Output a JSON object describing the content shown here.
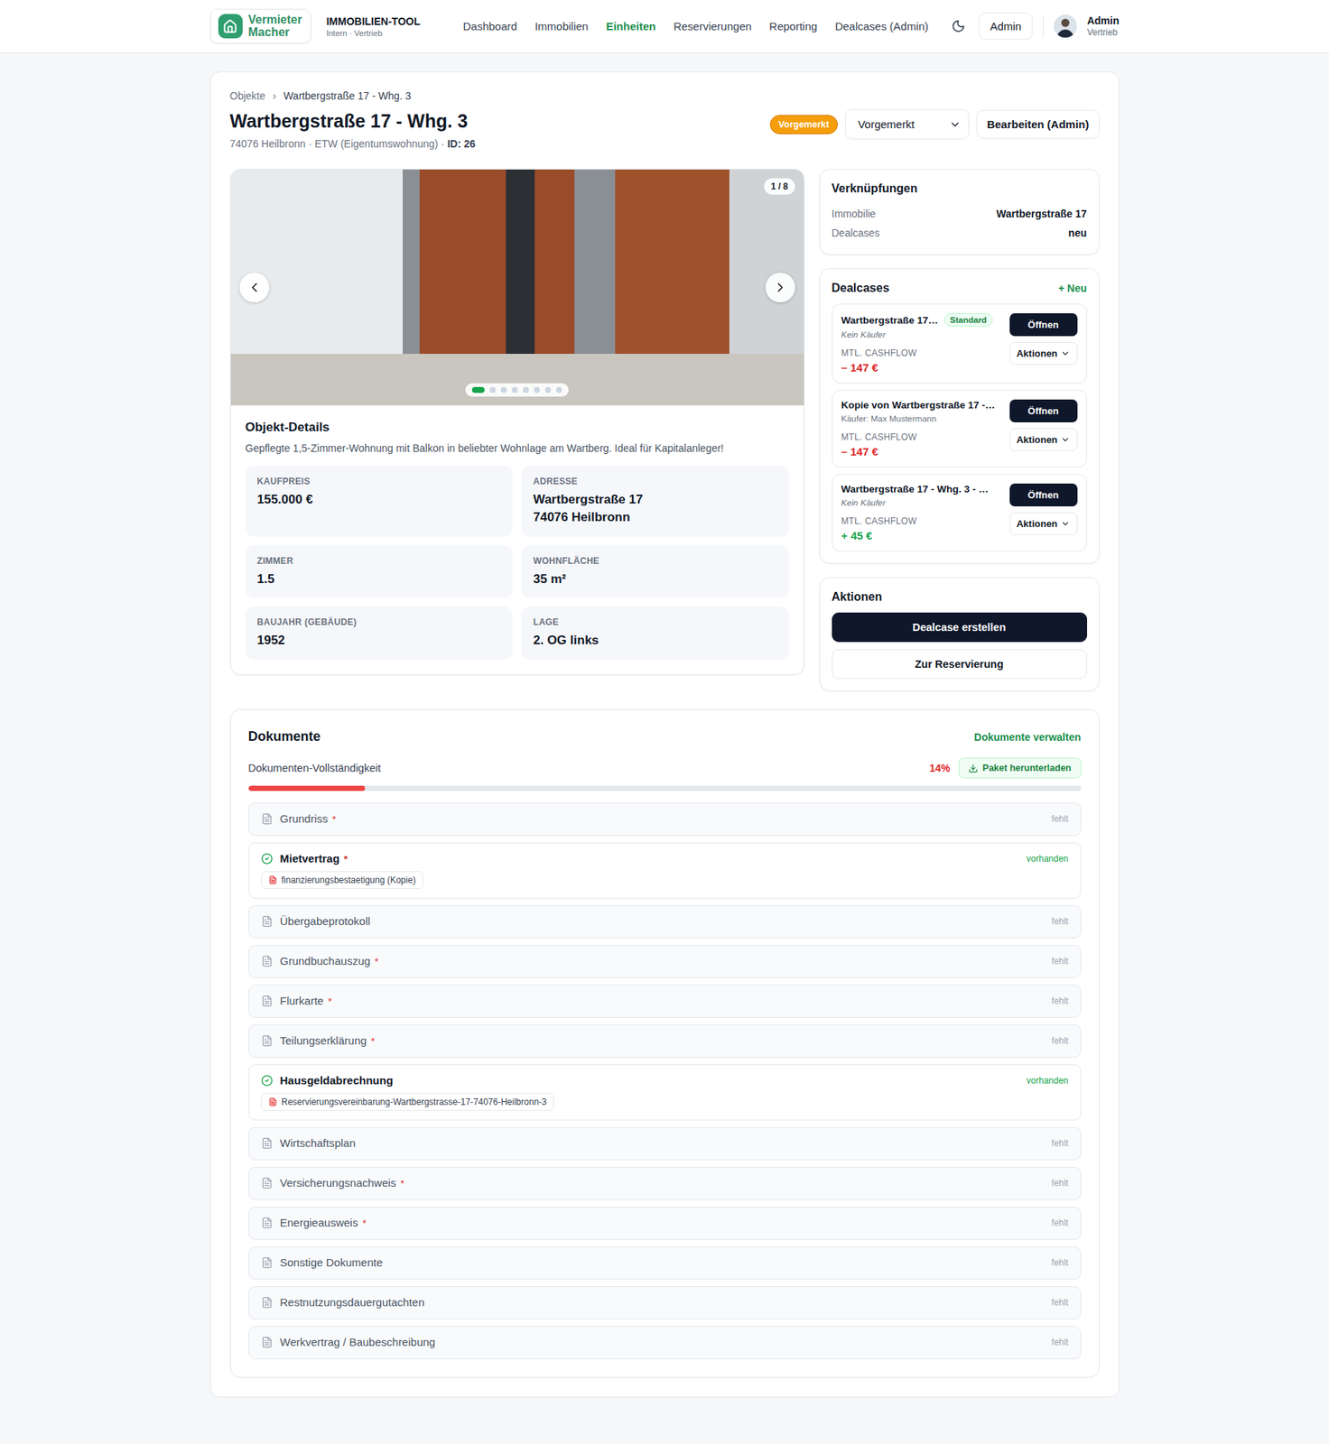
{
  "header": {
    "logo": {
      "line1": "Vermieter",
      "line2": "Macher"
    },
    "app_title": "IMMOBILIEN-TOOL",
    "app_subtitle": "Intern · Vertrieb",
    "nav": [
      {
        "label": "Dashboard",
        "selected": false
      },
      {
        "label": "Immobilien",
        "selected": false
      },
      {
        "label": "Einheiten",
        "selected": true
      },
      {
        "label": "Reservierungen",
        "selected": false
      },
      {
        "label": "Reporting",
        "selected": false
      },
      {
        "label": "Dealcases (Admin)",
        "selected": false
      }
    ],
    "role_button": "Admin",
    "user": {
      "name": "Admin",
      "role": "Vertrieb"
    }
  },
  "breadcrumb": {
    "parent": "Objekte",
    "separator": "›",
    "current": "Wartbergstraße 17 - Whg. 3"
  },
  "title": "Wartbergstraße 17 - Whg. 3",
  "subtitle": "74076 Heilbronn · ETW (Eigentumswohnung) · ",
  "id_label": "ID: 26",
  "status_badge": "Vorgemerkt",
  "status_select": "Vorgemerkt",
  "edit_button": "Bearbeiten (Admin)",
  "gallery": {
    "counter": "1 / 8",
    "dots": [
      {
        "selected": true
      },
      {
        "selected": false
      },
      {
        "selected": false
      },
      {
        "selected": false
      },
      {
        "selected": false
      },
      {
        "selected": false
      },
      {
        "selected": false
      },
      {
        "selected": false
      }
    ]
  },
  "details": {
    "title": "Objekt-Details",
    "description": "Gepflegte 1,5-Zimmer-Wohnung mit Balkon in beliebter Wohnlage am Wartberg. Ideal für Kapitalanleger!",
    "fields": [
      {
        "label": "KAUFPREIS",
        "lines": [
          "155.000 €"
        ]
      },
      {
        "label": "ADRESSE",
        "lines": [
          "Wartbergstraße 17",
          "74076 Heilbronn"
        ]
      },
      {
        "label": "ZIMMER",
        "lines": [
          "1.5"
        ]
      },
      {
        "label": "WOHNFLÄCHE",
        "lines": [
          "35 m²"
        ]
      },
      {
        "label": "BAUJAHR (GEBÄUDE)",
        "lines": [
          "1952"
        ]
      },
      {
        "label": "LAGE",
        "lines": [
          "2. OG links"
        ]
      }
    ]
  },
  "links": {
    "title": "Verknüpfungen",
    "rows": [
      {
        "label": "Immobilie",
        "value": "Wartbergstraße 17"
      },
      {
        "label": "Dealcases",
        "value": "neu"
      }
    ]
  },
  "dealcases": {
    "title": "Dealcases",
    "new_button": "+ Neu",
    "items": [
      {
        "title": "Wartbergstraße 17…",
        "tag": "Standard",
        "buyer": "Kein Käufer",
        "no_buyer": true,
        "cashflow_label": "MTL. CASHFLOW",
        "cashflow": "– 147 €",
        "positive": false,
        "open_button": "Öffnen",
        "actions_button": "Aktionen"
      },
      {
        "title": "Kopie von Wartbergstraße 17 -…",
        "tag": "",
        "buyer": "Käufer: Max Mustermann",
        "no_buyer": false,
        "cashflow_label": "MTL. CASHFLOW",
        "cashflow": "– 147 €",
        "positive": false,
        "open_button": "Öffnen",
        "actions_button": "Aktionen"
      },
      {
        "title": "Wartbergstraße 17 - Whg. 3 - …",
        "tag": "",
        "buyer": "Kein Käufer",
        "no_buyer": true,
        "cashflow_label": "MTL. CASHFLOW",
        "cashflow": "+ 45 €",
        "positive": true,
        "open_button": "Öffnen",
        "actions_button": "Aktionen"
      }
    ]
  },
  "actions": {
    "title": "Aktionen",
    "buttons": [
      {
        "label": "Dealcase erstellen",
        "kind": "primary"
      },
      {
        "label": "Zur Reservierung",
        "kind": "secondary"
      }
    ]
  },
  "documents": {
    "title": "Dokumente",
    "manage_link": "Dokumente verwalten",
    "completeness_label": "Dokumenten-Vollständigkeit",
    "percent": "14%",
    "level": 0.14,
    "download_button": "Paket herunterladen",
    "required_mark": "*",
    "items": [
      {
        "name": "Grundriss",
        "required": true,
        "present": false,
        "status": "fehlt",
        "files": []
      },
      {
        "name": "Mietvertrag",
        "required": true,
        "present": true,
        "status": "vorhanden",
        "files": [
          "finanzierungsbestaetigung (Kopie)"
        ]
      },
      {
        "name": "Übergabeprotokoll",
        "required": false,
        "present": false,
        "status": "fehlt",
        "files": []
      },
      {
        "name": "Grundbuchauszug",
        "required": true,
        "present": false,
        "status": "fehlt",
        "files": []
      },
      {
        "name": "Flurkarte",
        "required": true,
        "present": false,
        "status": "fehlt",
        "files": []
      },
      {
        "name": "Teilungserklärung",
        "required": true,
        "present": false,
        "status": "fehlt",
        "files": []
      },
      {
        "name": "Hausgeldabrechnung",
        "required": false,
        "present": true,
        "status": "vorhanden",
        "files": [
          "Reservierungsvereinbarung-Wartbergstrasse-17-74076-Heilbronn-3"
        ]
      },
      {
        "name": "Wirtschaftsplan",
        "required": false,
        "present": false,
        "status": "fehlt",
        "files": []
      },
      {
        "name": "Versicherungsnachweis",
        "required": true,
        "present": false,
        "status": "fehlt",
        "files": []
      },
      {
        "name": "Energieausweis",
        "required": true,
        "present": false,
        "status": "fehlt",
        "files": []
      },
      {
        "name": "Sonstige Dokumente",
        "required": false,
        "present": false,
        "status": "fehlt",
        "files": []
      },
      {
        "name": "Restnutzungsdauergutachten",
        "required": false,
        "present": false,
        "status": "fehlt",
        "files": []
      },
      {
        "name": "Werkvertrag / Baubeschreibung",
        "required": false,
        "present": false,
        "status": "fehlt",
        "files": []
      }
    ]
  }
}
